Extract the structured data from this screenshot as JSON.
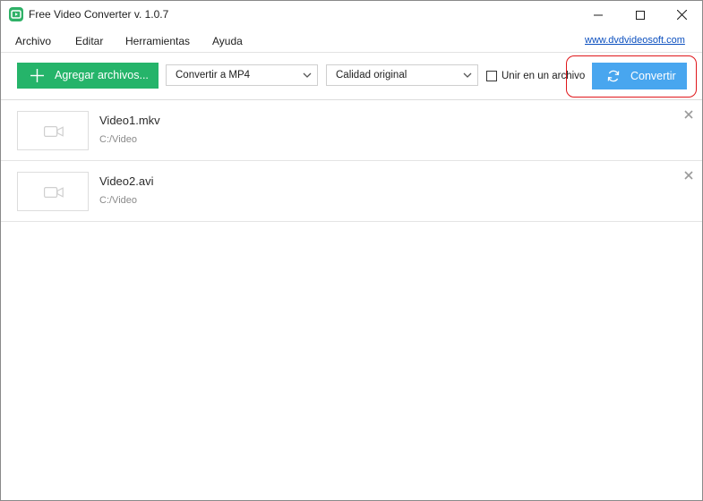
{
  "window": {
    "title": "Free Video Converter v. 1.0.7"
  },
  "menu": {
    "items": [
      {
        "label": "Archivo"
      },
      {
        "label": "Editar"
      },
      {
        "label": "Herramientas"
      },
      {
        "label": "Ayuda"
      }
    ],
    "site_link": "www.dvdvideosoft.com"
  },
  "toolbar": {
    "add_label": "Agregar archivos...",
    "format_selected": "Convertir a MP4",
    "quality_selected": "Calidad original",
    "merge_label": "Unir en un archivo",
    "merge_checked": false,
    "convert_label": "Convertir"
  },
  "files": [
    {
      "name": "Video1.mkv",
      "path": "C:/Video"
    },
    {
      "name": "Video2.avi",
      "path": "C:/Video"
    }
  ],
  "colors": {
    "add_button": "#25b46a",
    "convert_button": "#48a6ef",
    "highlight": "#e0171b",
    "link": "#0b4fbf"
  }
}
